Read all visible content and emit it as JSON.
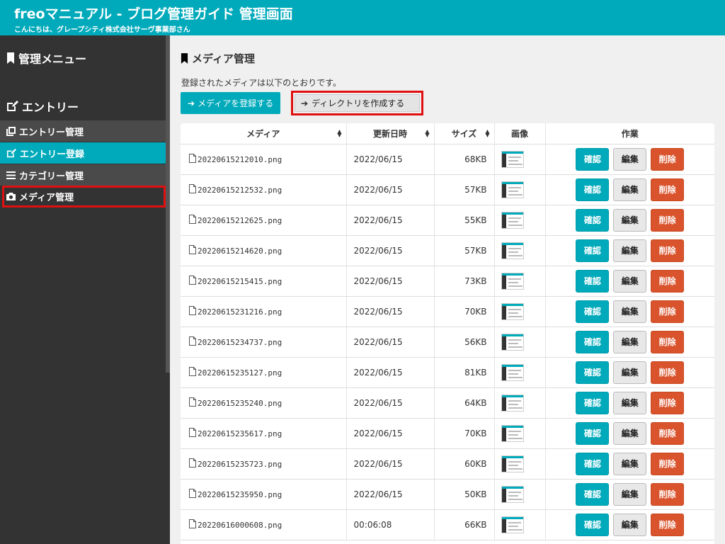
{
  "header": {
    "title": "freoマニュアル - ブログ管理ガイド 管理画面",
    "greeting": "こんにちは、グレープシティ株式会社サーヴ事業部さん"
  },
  "sidebar": {
    "menu_heading": "管理メニュー",
    "entry_heading": "エントリー",
    "items": [
      {
        "label": "エントリー管理",
        "icon": "copy-icon"
      },
      {
        "label": "エントリー登録",
        "icon": "edit-icon"
      },
      {
        "label": "カテゴリー管理",
        "icon": "list-icon"
      },
      {
        "label": "メディア管理",
        "icon": "camera-icon"
      }
    ]
  },
  "main": {
    "title": "メディア管理",
    "lead": "登録されたメディアは以下のとおりです。",
    "register_button": "メディアを登録する",
    "mkdir_button": "ディレクトリを作成する",
    "table": {
      "headers": [
        "メディア",
        "更新日時",
        "サイズ",
        "画像",
        "作業"
      ],
      "action_labels": {
        "confirm": "確認",
        "edit": "編集",
        "delete": "削除"
      },
      "rows": [
        {
          "file": "20220615212010.png",
          "date": "2022/06/15",
          "size": "68KB"
        },
        {
          "file": "20220615212532.png",
          "date": "2022/06/15",
          "size": "57KB"
        },
        {
          "file": "20220615212625.png",
          "date": "2022/06/15",
          "size": "55KB"
        },
        {
          "file": "20220615214620.png",
          "date": "2022/06/15",
          "size": "57KB"
        },
        {
          "file": "20220615215415.png",
          "date": "2022/06/15",
          "size": "73KB"
        },
        {
          "file": "20220615231216.png",
          "date": "2022/06/15",
          "size": "70KB"
        },
        {
          "file": "20220615234737.png",
          "date": "2022/06/15",
          "size": "56KB"
        },
        {
          "file": "20220615235127.png",
          "date": "2022/06/15",
          "size": "81KB"
        },
        {
          "file": "20220615235240.png",
          "date": "2022/06/15",
          "size": "64KB"
        },
        {
          "file": "20220615235617.png",
          "date": "2022/06/15",
          "size": "70KB"
        },
        {
          "file": "20220615235723.png",
          "date": "2022/06/15",
          "size": "60KB"
        },
        {
          "file": "20220615235950.png",
          "date": "2022/06/15",
          "size": "50KB"
        },
        {
          "file": "20220616000608.png",
          "date": "00:06:08",
          "size": "66KB"
        }
      ]
    }
  },
  "colors": {
    "accent": "#00aabb",
    "sidebar": "#333333",
    "danger": "#d9532c",
    "highlight": "#e01010"
  }
}
